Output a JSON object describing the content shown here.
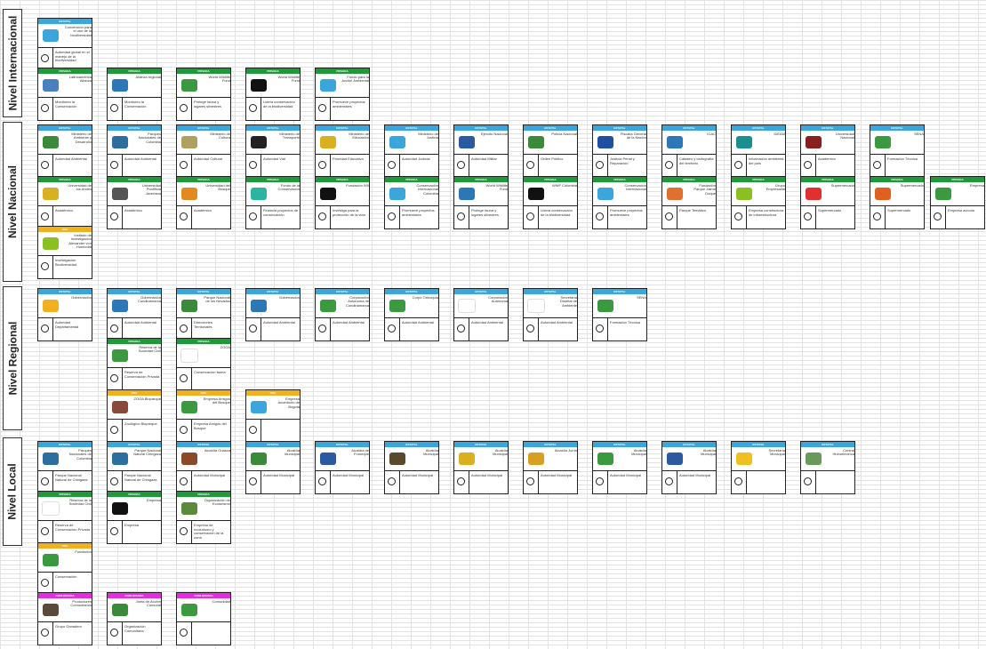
{
  "levels": [
    {
      "label": "Nivel Internacional"
    },
    {
      "label": "Nivel Nacional"
    },
    {
      "label": "Nivel Regional"
    },
    {
      "label": "Nivel Local"
    }
  ],
  "colors": {
    "publica": "#3aa6dc",
    "privada": "#1f9a3a",
    "ong": "#f0b020",
    "comunitaria": "#e62ce0",
    "grid": "#d9d9d9"
  },
  "card_types": {
    "publica": "ESTATAL",
    "privada": "PRIVADA",
    "ong": "ONG",
    "comunitaria": "COMUNITARIA"
  },
  "cards": [
    {
      "type": "publica",
      "name": "Convención para el uso de la biodiversidad",
      "role": "Autoridad global en el manejo de la biodiversidad",
      "logo_color": "#3aa6dc",
      "logo_icon": "globe-logo-icon"
    },
    {
      "type": "privada",
      "name": "Latinoamérica Alianza",
      "role": "Monitoreo la Conservación",
      "logo_color": "#4a7fc0",
      "logo_icon": "alianza-logo-icon"
    },
    {
      "type": "privada",
      "name": "Alianza regional",
      "role": "Monitoreo la Conservación",
      "logo_color": "#2c77b5",
      "logo_icon": "bird-logo-icon"
    },
    {
      "type": "privada",
      "name": "World Wildlife Fund",
      "role": "Protege fauna y lugares silvestres",
      "logo_color": "#3b9a40",
      "logo_icon": "globe-logo-icon"
    },
    {
      "type": "privada",
      "name": "World Wildlife Fund",
      "role": "Lidera conservación de la biodiversidad",
      "logo_color": "#111111",
      "logo_icon": "panda-logo-icon"
    },
    {
      "type": "privada",
      "name": "Fondo para la Acción Ambiental",
      "role": "Promueve proyectos ambientales",
      "logo_color": "#3aa6dc",
      "logo_icon": "pin-logo-icon"
    },
    {
      "type": "publica",
      "name": "Ministerio de Ambiente y Desarrollo",
      "role": "Autoridad Ambiental",
      "logo_color": "#3b8a3a",
      "logo_icon": "seal-logo-icon"
    },
    {
      "type": "publica",
      "name": "Parques Nacionales de Colombia",
      "role": "Autoridad Ambiental",
      "logo_color": "#2d6e9e",
      "logo_icon": "park-logo-icon"
    },
    {
      "type": "publica",
      "name": "Ministerio de Cultura",
      "role": "Autoridad Cultural",
      "logo_color": "#b0a060",
      "logo_icon": "building-logo-icon"
    },
    {
      "type": "publica",
      "name": "Ministerio de Transporte",
      "role": "Autoridad Vial",
      "logo_color": "#222222",
      "logo_icon": "transport-logo-icon"
    },
    {
      "type": "publica",
      "name": "Ministerio de Educación",
      "role": "Prioridad Educativa",
      "logo_color": "#d8b020",
      "logo_icon": "education-logo-icon"
    },
    {
      "type": "publica",
      "name": "Ministerio de Justicia",
      "role": "Autoridad Judicial",
      "logo_color": "#3aa6dc",
      "logo_icon": "justice-logo-icon"
    },
    {
      "type": "publica",
      "name": "Ejército Nacional",
      "role": "Autoridad Militar",
      "logo_color": "#2c5aa0",
      "logo_icon": "army-logo-icon"
    },
    {
      "type": "publica",
      "name": "Policía Nacional",
      "role": "Orden Público",
      "logo_color": "#3b8a3a",
      "logo_icon": "police-logo-icon"
    },
    {
      "type": "publica",
      "name": "Fiscalía General de la Nación",
      "role": "Justicia Penal y Reparación",
      "logo_color": "#1f4fa0",
      "logo_icon": "fiscalia-logo-icon"
    },
    {
      "type": "publica",
      "name": "IGAC",
      "role": "Catastro y cartografía del territorio",
      "logo_color": "#2c77b5",
      "logo_icon": "igac-logo-icon"
    },
    {
      "type": "publica",
      "name": "IDEAM",
      "role": "Información ambiental del país",
      "logo_color": "#1a8f8f",
      "logo_icon": "ideam-logo-icon"
    },
    {
      "type": "publica",
      "name": "Universidad Nacional",
      "role": "Académico",
      "logo_color": "#8a1f1f",
      "logo_icon": "unal-logo-icon"
    },
    {
      "type": "publica",
      "name": "SENA",
      "role": "Formación Técnica",
      "logo_color": "#3b9a40",
      "logo_icon": "sena-logo-icon"
    },
    {
      "type": "privada",
      "name": "Universidad de los Andes",
      "role": "Académico",
      "logo_color": "#d8b020",
      "logo_icon": "uniandes-logo-icon"
    },
    {
      "type": "privada",
      "name": "Universidad Pontificia Javeriana",
      "role": "Académico",
      "logo_color": "#555555",
      "logo_icon": "javeriana-logo-icon"
    },
    {
      "type": "privada",
      "name": "Universidad del Bosque",
      "role": "Académico",
      "logo_color": "#e08a20",
      "logo_icon": "bosque-logo-icon"
    },
    {
      "type": "privada",
      "name": "Fondo de la Conservación",
      "role": "Financia proyectos de conservación",
      "logo_color": "#2bb5a0",
      "logo_icon": "leaf-logo-icon"
    },
    {
      "type": "privada",
      "name": "Fundación WII",
      "role": "Investiga para la protección de la vida",
      "logo_color": "#111111",
      "logo_icon": "wii-logo-icon"
    },
    {
      "type": "privada",
      "name": "Conservación Internacional Colombia",
      "role": "Promueve proyectos ambientales",
      "logo_color": "#3aa6dc",
      "logo_icon": "ci-logo-icon"
    },
    {
      "type": "privada",
      "name": "World Wildlife Fund",
      "role": "Protege fauna y lugares silvestres",
      "logo_color": "#2c77b5",
      "logo_icon": "globe-logo-icon"
    },
    {
      "type": "privada",
      "name": "WWF Colombia",
      "role": "Lidera conservación de la biodiversidad",
      "logo_color": "#111111",
      "logo_icon": "panda-logo-icon"
    },
    {
      "type": "privada",
      "name": "Conservación Internacional",
      "role": "Promueve proyectos ambientales",
      "logo_color": "#3aa6dc",
      "logo_icon": "pin-logo-icon"
    },
    {
      "type": "privada",
      "name": "Fundación Parque Jaime Duque",
      "role": "Parque Temático",
      "logo_color": "#e07030",
      "logo_icon": "jaimeduque-logo-icon"
    },
    {
      "type": "privada",
      "name": "Grupo Empresarial",
      "role": "Empresa constructora de infraestructura",
      "logo_color": "#8ac020",
      "logo_icon": "company-logo-icon"
    },
    {
      "type": "privada",
      "name": "Supermercado",
      "role": "Supermercado",
      "logo_color": "#e03030",
      "logo_icon": "market-logo-icon"
    },
    {
      "type": "privada",
      "name": "Supermercado",
      "role": "Supermercado",
      "logo_color": "#e06020",
      "logo_icon": "market-logo-icon"
    },
    {
      "type": "privada",
      "name": "Empresa",
      "role": "Empresa avícola",
      "logo_color": "#3b9a40",
      "logo_icon": "company-logo-icon"
    },
    {
      "type": "ong",
      "name": "Instituto de Investigación Alexander von Humboldt",
      "role": "Investigación Biodiversidad",
      "logo_color": "#8ac020",
      "logo_icon": "humboldt-logo-icon"
    },
    {
      "type": "publica",
      "name": "Gobernación",
      "role": "Autoridad Departamental",
      "logo_color": "#f0b020",
      "logo_icon": "sun-logo-icon"
    },
    {
      "type": "publica",
      "name": "Gobernación Cundinamarca",
      "role": "Autoridad Ambiental",
      "logo_color": "#2c77b5",
      "logo_icon": "cundinamarca-logo-icon"
    },
    {
      "type": "publica",
      "name": "Parque Nacional de los Nevados",
      "role": "Direcciones Territoriales",
      "logo_color": "#3b8a3a",
      "logo_icon": "park-logo-icon"
    },
    {
      "type": "publica",
      "name": "Gobernación",
      "role": "Autoridad Ambiental",
      "logo_color": "#2c77b5",
      "logo_icon": "seal-logo-icon"
    },
    {
      "type": "publica",
      "name": "Corporación Autónoma de Cundinamarca",
      "role": "Autoridad Ambiental",
      "logo_color": "#3b9a40",
      "logo_icon": "car-logo-icon"
    },
    {
      "type": "publica",
      "name": "Corpo Orinoquia",
      "role": "Autoridad Ambiental",
      "logo_color": "#3b9a40",
      "logo_icon": "corpo-logo-icon"
    },
    {
      "type": "publica",
      "name": "Corporación Autónoma",
      "role": "Autoridad Ambiental",
      "logo_color": "#ffffff",
      "logo_icon": "blank-logo-icon"
    },
    {
      "type": "publica",
      "name": "Secretaría Distrital de Ambiente",
      "role": "Autoridad Ambiental",
      "logo_color": "#ffffff",
      "logo_icon": "blank-logo-icon"
    },
    {
      "type": "publica",
      "name": "SENA",
      "role": "Formación Técnica",
      "logo_color": "#3b9a40",
      "logo_icon": "sena-logo-icon"
    },
    {
      "type": "privada",
      "name": "Reserva de la Sociedad Civil",
      "role": "Reserva de Conservación Privada",
      "logo_color": "#3b9a40",
      "logo_icon": "reserve-logo-icon"
    },
    {
      "type": "privada",
      "name": "ZOOA",
      "role": "Conservación fauna",
      "logo_color": "#ffffff",
      "logo_icon": "blank-logo-icon"
    },
    {
      "type": "ong",
      "name": "ZOOA Bioparque",
      "role": "Zoológico Bioparque",
      "logo_color": "#8a4a3a",
      "logo_icon": "bioparque-logo-icon"
    },
    {
      "type": "ong",
      "name": "Empresa Amigos del Bosque",
      "role": "Empresa Amigos del Bosque",
      "logo_color": "#3b9a40",
      "logo_icon": "forest-logo-icon"
    },
    {
      "type": "ong",
      "name": "Empresa Acueducto de Bogotá",
      "role": "",
      "logo_color": "#3aa6dc",
      "logo_icon": "water-logo-icon"
    },
    {
      "type": "publica",
      "name": "Parques Nacionales de Colombia",
      "role": "Parque Nacional Natural de Chingaza",
      "logo_color": "#2d6e9e",
      "logo_icon": "park-logo-icon"
    },
    {
      "type": "publica",
      "name": "Parque Nacional Natural Chingaza",
      "role": "Parque Nacional Natural de Chingaza",
      "logo_color": "#2d6e9e",
      "logo_icon": "park-logo-icon"
    },
    {
      "type": "publica",
      "name": "Alcaldía Guasca",
      "role": "Autoridad Municipal",
      "logo_color": "#8a4a2a",
      "logo_icon": "crest-logo-icon"
    },
    {
      "type": "publica",
      "name": "Alcaldía Municipal",
      "role": "Autoridad Municipal",
      "logo_color": "#3b8a3a",
      "logo_icon": "crest-logo-icon"
    },
    {
      "type": "publica",
      "name": "Alcaldía de Fómeque",
      "role": "Autoridad Municipal",
      "logo_color": "#2c5aa0",
      "logo_icon": "crest-logo-icon"
    },
    {
      "type": "publica",
      "name": "Alcaldía Municipal",
      "role": "Autoridad Municipal",
      "logo_color": "#5a4a2a",
      "logo_icon": "crest-logo-icon"
    },
    {
      "type": "publica",
      "name": "Alcaldía Municipal",
      "role": "Autoridad Municipal",
      "logo_color": "#d8b020",
      "logo_icon": "crest-logo-icon"
    },
    {
      "type": "publica",
      "name": "Alcaldía Junín",
      "role": "Autoridad Municipal",
      "logo_color": "#d8a020",
      "logo_icon": "crest-logo-icon"
    },
    {
      "type": "publica",
      "name": "Alcaldía Municipal",
      "role": "Autoridad Municipal",
      "logo_color": "#3b9a40",
      "logo_icon": "crest-logo-icon"
    },
    {
      "type": "publica",
      "name": "Alcaldía Municipal",
      "role": "Autoridad Municipal",
      "logo_color": "#2c5aa0",
      "logo_icon": "crest-logo-icon"
    },
    {
      "type": "publica",
      "name": "Secretaría Municipal",
      "role": "",
      "logo_color": "#f0c020",
      "logo_icon": "sun-logo-icon"
    },
    {
      "type": "publica",
      "name": "Central Hidroeléctrica",
      "role": "",
      "logo_color": "#6a9a5a",
      "logo_icon": "landscape-logo-icon"
    },
    {
      "type": "privada",
      "name": "Reserva de la Sociedad Civil",
      "role": "Reserva de Conservación Privada",
      "logo_color": "#ffffff",
      "logo_icon": "blank-logo-icon"
    },
    {
      "type": "privada",
      "name": "Empresa",
      "role": "Empresa",
      "logo_color": "#111111",
      "logo_icon": "company-logo-icon"
    },
    {
      "type": "privada",
      "name": "Organización de Ecoturismo",
      "role": "Empresa de ecoturismo y conservación de la zona",
      "logo_color": "#5a8a3a",
      "logo_icon": "landscape-logo-icon"
    },
    {
      "type": "ong",
      "name": "Fundación",
      "role": "Conservación",
      "logo_color": "#3b9a40",
      "logo_icon": "wave-logo-icon"
    },
    {
      "type": "comunitaria",
      "name": "Productores Comunitarios",
      "role": "Grupo Ganadero",
      "logo_color": "#5a4a3a",
      "logo_icon": "cattle-logo-icon"
    },
    {
      "type": "comunitaria",
      "name": "Junta de Acción Comunal",
      "role": "Organización Comunitaria",
      "logo_color": "#3b8a3a",
      "logo_icon": "crest-logo-icon"
    },
    {
      "type": "comunitaria",
      "name": "Comunidad",
      "role": "",
      "logo_color": "#3b9a40",
      "logo_icon": "community-logo-icon"
    }
  ]
}
